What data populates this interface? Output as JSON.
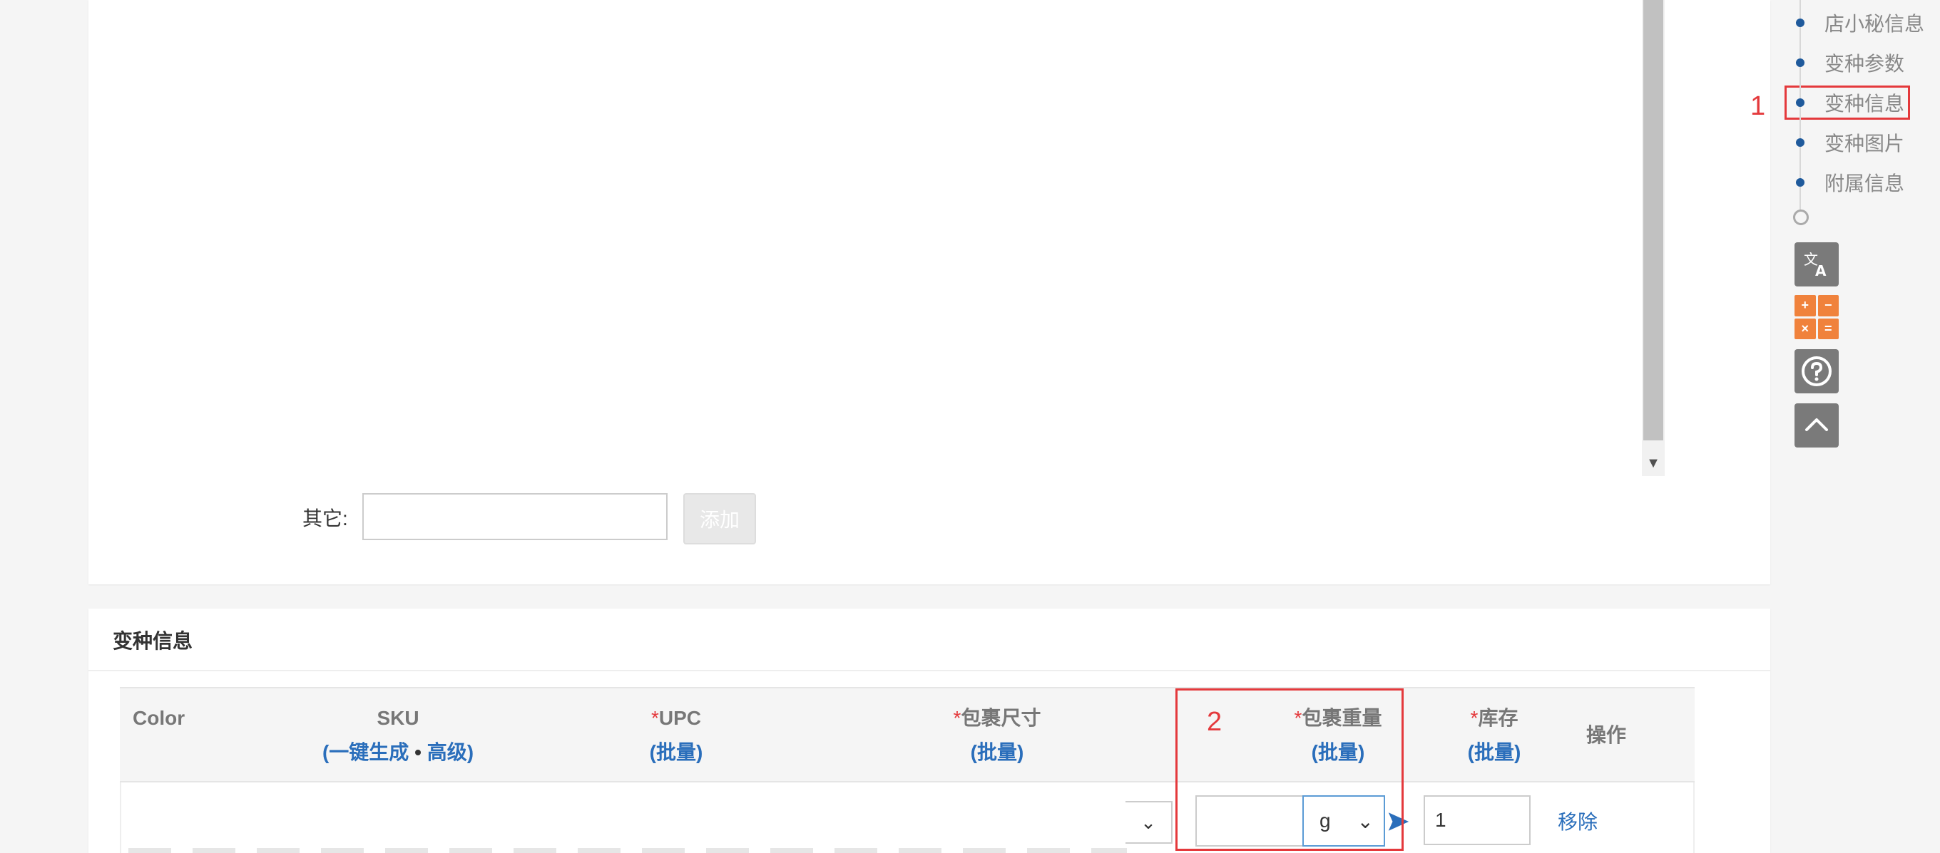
{
  "attributes_panel": {
    "other_label": "其它:",
    "other_input_value": "",
    "add_button_label": "添加"
  },
  "variant_panel": {
    "title": "变种信息",
    "headers": {
      "color": "Color",
      "sku": "SKU",
      "sku_generate": "一键生成",
      "sku_separator": "•",
      "sku_advanced": "高级",
      "upc": "UPC",
      "package_size": "包裹尺寸",
      "package_weight": "包裹重量",
      "stock": "库存",
      "action": "操作",
      "required_mark": "*",
      "batch": "批量",
      "paren_open": "(",
      "paren_close": ")"
    },
    "row": {
      "weight_value": "",
      "weight_unit": "g",
      "stock_value": "1",
      "remove_label": "移除"
    }
  },
  "side_nav": {
    "items": [
      {
        "label": "店小秘信息"
      },
      {
        "label": "变种参数"
      },
      {
        "label": "变种信息"
      },
      {
        "label": "变种图片"
      },
      {
        "label": "附属信息"
      }
    ],
    "tools": [
      "translate-icon",
      "calculator-icon",
      "help-icon",
      "back-to-top-icon"
    ],
    "accent_color": "#1f5a9c"
  },
  "annotations": [
    {
      "number": "1"
    },
    {
      "number": "2"
    }
  ],
  "colors": {
    "link": "#2a6ebb",
    "required": "#e4393c",
    "annotation": "#e4393c",
    "calculator": "#f0823c"
  }
}
